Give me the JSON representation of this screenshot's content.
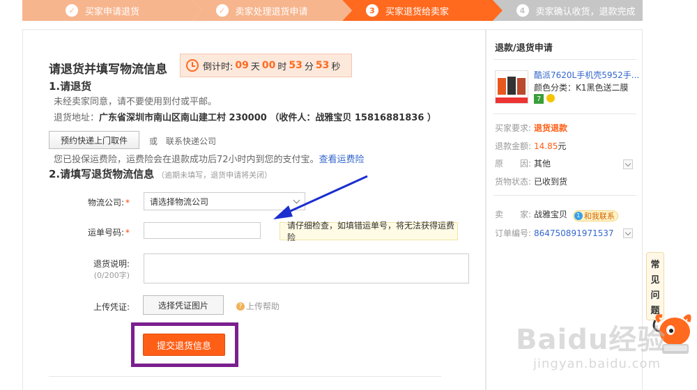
{
  "steps": [
    {
      "num": "✓",
      "label": "买家申请退货"
    },
    {
      "num": "✓",
      "label": "卖家处理退货申请"
    },
    {
      "num": "3",
      "label": "买家退货给卖家"
    },
    {
      "num": "4",
      "label": "卖家确认收货，退款完成"
    }
  ],
  "main": {
    "title": "请退货并填写物流信息",
    "countdown": {
      "prefix": "倒计时:",
      "days": "09",
      "days_unit": "天",
      "hours": "00",
      "hours_unit": "时",
      "minutes": "53",
      "minutes_unit": "分",
      "seconds": "53",
      "seconds_unit": "秒"
    },
    "section1": {
      "heading": "1.请退货",
      "note": "未经卖家同意，请不要使用到付或平邮。",
      "address_label": "退货地址：",
      "address_value": "广东省深圳市南山区南山建工村 230000 （收件人：战雅宝贝 15816881836 ）",
      "pickup_button": "预约快递上门取件",
      "or": "或",
      "contact_express": "联系快递公司",
      "insurance_text": "您已投保运费险，运费险会在退款成功后72小时内到您的支付宝。",
      "insurance_link": "查看运费险"
    },
    "section2": {
      "heading": "2.请填写退货物流信息",
      "heading_note": "（逾期未填写，退货申请将关闭）",
      "company_label": "物流公司:",
      "company_value": "请选择物流公司",
      "tracking_label": "运单号码:",
      "tracking_value": "",
      "tracking_tip": "请仔细检查，如填错运单号，将无法获得运费险",
      "desc_label": "退货说明:",
      "desc_count": "(0/200字)",
      "desc_value": "",
      "voucher_label": "上传凭证:",
      "voucher_button": "选择凭证图片",
      "upload_help": "上传帮助",
      "required_mark": "*",
      "submit": "提交退货信息"
    }
  },
  "side": {
    "title": "退款/退货申请",
    "product_name": "酷派7620L手机壳5952手...",
    "product_color": "颜色分类：K1黑色送二膜",
    "badge": "7",
    "rows": [
      {
        "k": "买家要求:",
        "v": "退货退款"
      },
      {
        "k": "退款金额:",
        "v": "14.85",
        "unit": "元"
      },
      {
        "k": "原　　因:",
        "v": "其他"
      },
      {
        "k": "货物状态:",
        "v": "已收到货"
      },
      {
        "k": "卖　　家:",
        "v": "战雅宝贝",
        "contact": "和我联系"
      },
      {
        "k": "订单编号:",
        "v": "864750891971537"
      }
    ]
  },
  "faq": [
    "常",
    "见",
    "问",
    "题"
  ],
  "watermark": {
    "main": "Baidu经验",
    "sub": "jingyan.baidu.com"
  },
  "colors": {
    "accent": "#ff5e16",
    "step_done": "#f7b58e",
    "step_todo": "#c6c6c6",
    "link": "#3366cc",
    "highlight": "#7b1f8f"
  }
}
